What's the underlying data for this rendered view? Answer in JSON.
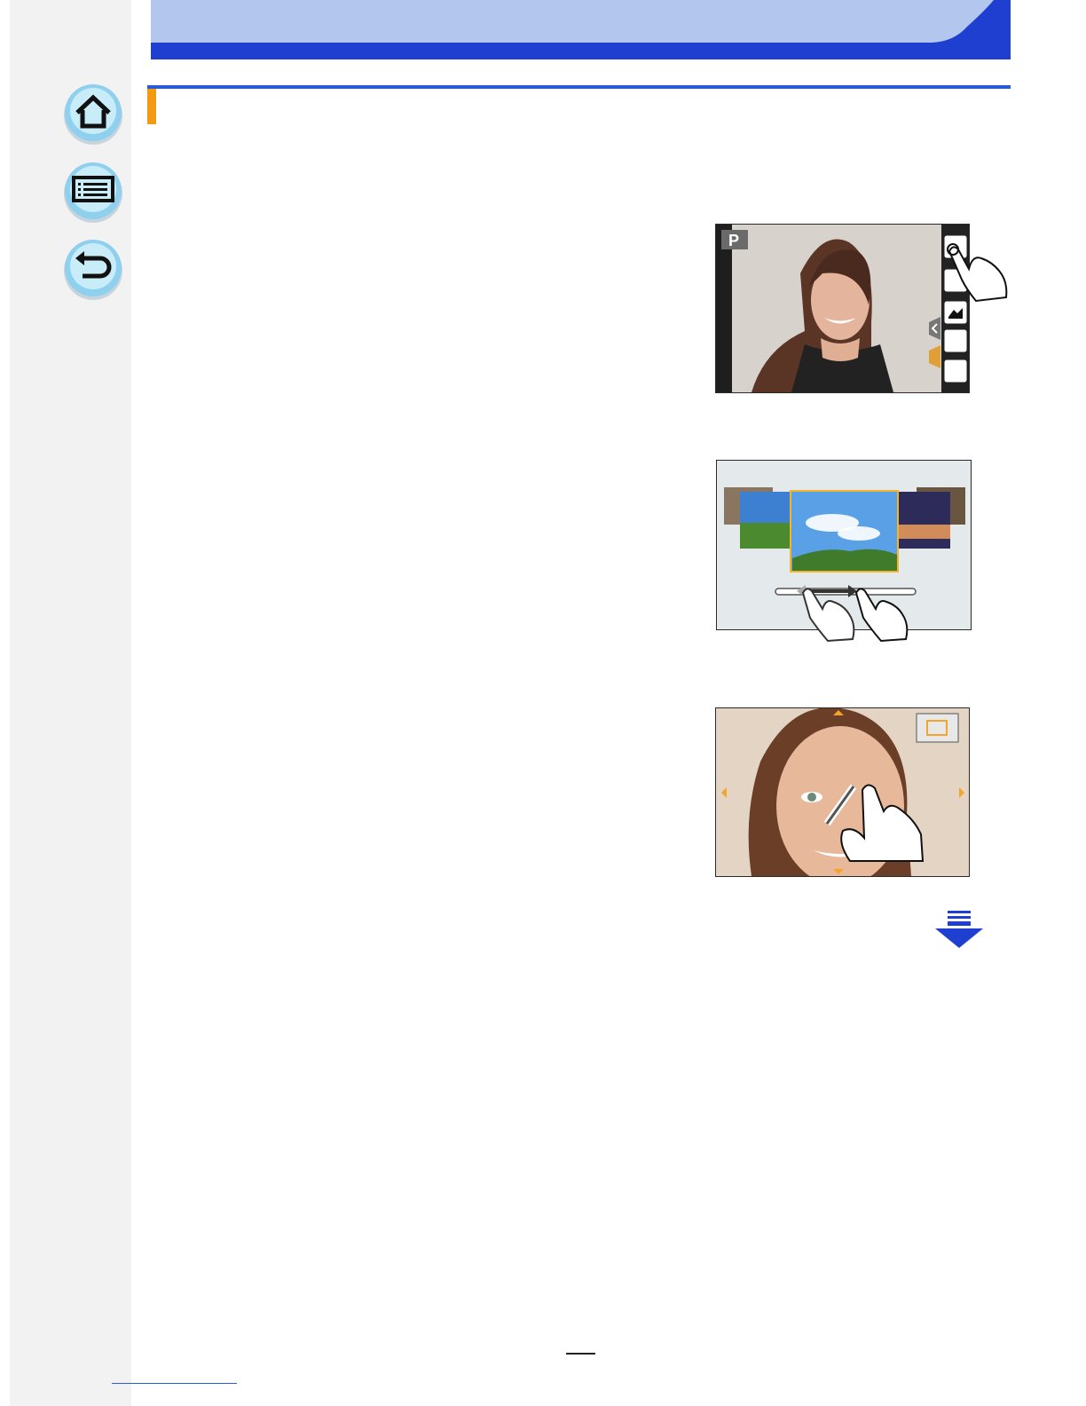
{
  "navigation": {
    "home_icon": "home-icon",
    "contents_icon": "list-icon",
    "back_icon": "return-icon"
  },
  "figures": {
    "touch_tab": {
      "mode_label": "P"
    }
  },
  "colors": {
    "header_light": "#b3c6ee",
    "header_dark": "#1f3fd1",
    "accent_orange": "#f39a12",
    "sidebar_bg": "#f2f2f2",
    "nav_button": "#8fd0ee"
  },
  "next_page_icon": "down-arrow-icon"
}
